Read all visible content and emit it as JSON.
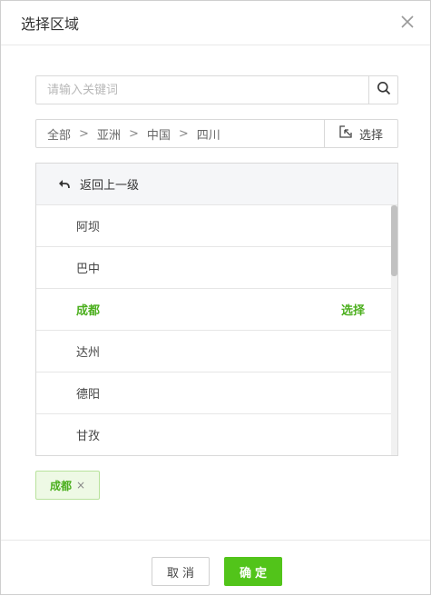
{
  "dialog": {
    "title": "选择区域"
  },
  "search": {
    "placeholder": "请输入关键词"
  },
  "breadcrumb": {
    "items": [
      "全部",
      "亚洲",
      "中国",
      "四川"
    ],
    "separator": ">",
    "select_label": "选择"
  },
  "list": {
    "back_label": "返回上一级",
    "items": [
      {
        "label": "阿坝"
      },
      {
        "label": "巴中"
      },
      {
        "label": "成都",
        "action": "选择"
      },
      {
        "label": "达州"
      },
      {
        "label": "德阳"
      },
      {
        "label": "甘孜"
      }
    ]
  },
  "selected_tags": [
    {
      "label": "成都",
      "remove": "×"
    }
  ],
  "footer": {
    "cancel_label": "取消",
    "ok_label": "确定"
  },
  "colors": {
    "accent": "#52c41a",
    "accent_text": "#4caf1e"
  }
}
